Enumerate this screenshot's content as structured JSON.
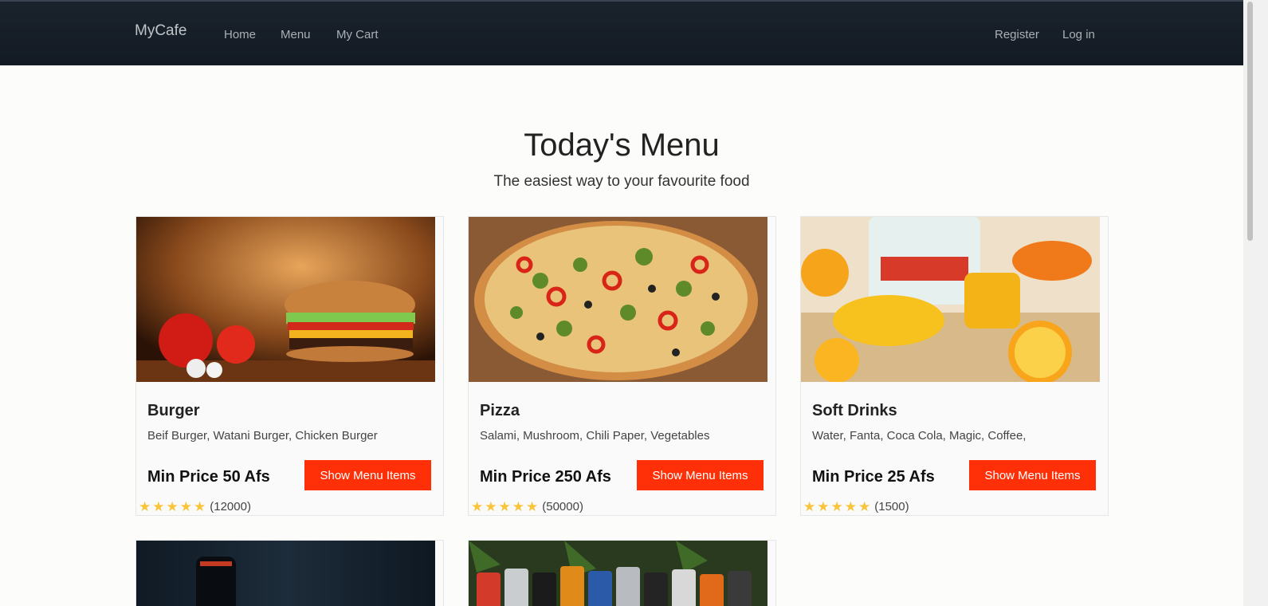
{
  "navbar": {
    "brand": "MyCafe",
    "links": [
      "Home",
      "Menu",
      "My Cart"
    ],
    "register": "Register",
    "login": "Log in"
  },
  "header": {
    "title": "Today's Menu",
    "subtitle": "The easiest way to your favourite food"
  },
  "cards": [
    {
      "title": "Burger",
      "description": "Beif Burger, Watani Burger, Chicken Burger",
      "price": "Min Price 50 Afs",
      "button": "Show Menu Items",
      "rating": 5,
      "rating_count": "(12000)",
      "image_icon": "burger-image"
    },
    {
      "title": "Pizza",
      "description": "Salami, Mushroom, Chili Paper, Vegetables",
      "price": "Min Price 250 Afs",
      "button": "Show Menu Items",
      "rating": 5,
      "rating_count": "(50000)",
      "image_icon": "pizza-image"
    },
    {
      "title": "Soft Drinks",
      "description": "Water, Fanta, Coca Cola, Magic, Coffee,",
      "price": "Min Price 25 Afs",
      "button": "Show Menu Items",
      "rating": 5,
      "rating_count": "(1500)",
      "image_icon": "orange-juice-image"
    }
  ],
  "colors": {
    "accent": "#ff3008",
    "star": "#f8c43a",
    "navbar": "#151c25"
  }
}
